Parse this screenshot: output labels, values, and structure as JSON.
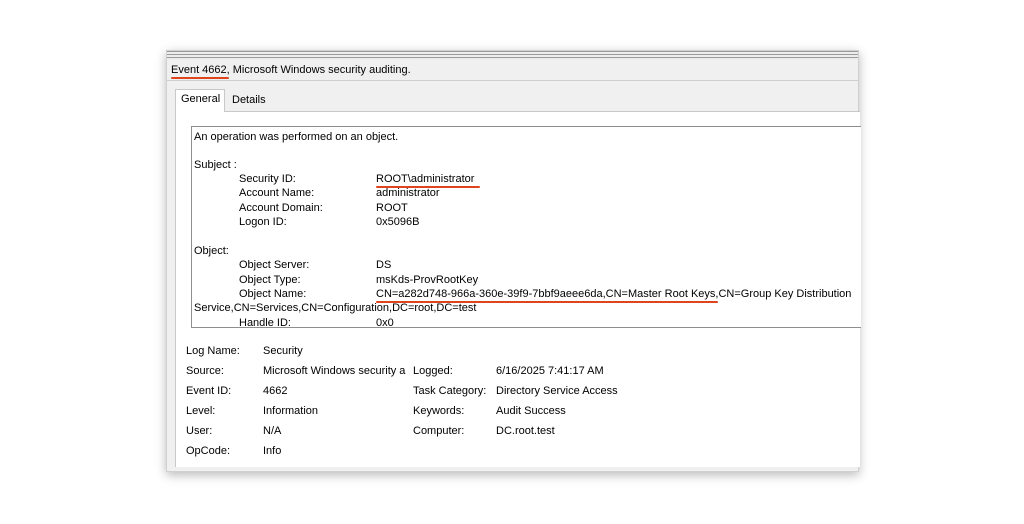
{
  "window": {
    "title": "Event 4662, Microsoft Windows security auditing."
  },
  "tabs": [
    {
      "label": "General",
      "active": true
    },
    {
      "label": "Details",
      "active": false
    }
  ],
  "description": {
    "intro": "An operation was performed on an object.",
    "subject": {
      "heading": "Subject :",
      "security_id_label": "Security ID:",
      "security_id": "ROOT\\administrator",
      "account_name_label": "Account Name:",
      "account_name": "administrator",
      "account_domain_label": "Account Domain:",
      "account_domain": "ROOT",
      "logon_id_label": "Logon ID:",
      "logon_id": "0x5096B"
    },
    "object": {
      "heading": "Object:",
      "object_server_label": "Object Server:",
      "object_server": "DS",
      "object_type_label": "Object Type:",
      "object_type": "msKds-ProvRootKey",
      "object_name_label": "Object Name:",
      "object_name_line1": "CN=a282d748-966a-360e-39f9-7bbf9aeee6da,CN=Master Root Keys,CN=Group Key Distribution",
      "object_name_line2": "Service,CN=Services,CN=Configuration,DC=root,DC=test",
      "handle_id_label": "Handle ID:",
      "handle_id": "0x0"
    }
  },
  "properties": {
    "log_name_label": "Log Name:",
    "log_name": "Security",
    "source_label": "Source:",
    "source": "Microsoft Windows security a",
    "logged_label": "Logged:",
    "logged": "6/16/2025 7:41:17 AM",
    "event_id_label": "Event ID:",
    "event_id": "4662",
    "task_category_label": "Task Category:",
    "task_category": "Directory Service Access",
    "level_label": "Level:",
    "level": "Information",
    "keywords_label": "Keywords:",
    "keywords": "Audit Success",
    "user_label": "User:",
    "user": "N/A",
    "computer_label": "Computer:",
    "computer": "DC.root.test",
    "opcode_label": "OpCode:",
    "opcode": "Info"
  },
  "colors": {
    "highlight_underline": "#e0441f",
    "window_bg": "#f0f0f0"
  }
}
